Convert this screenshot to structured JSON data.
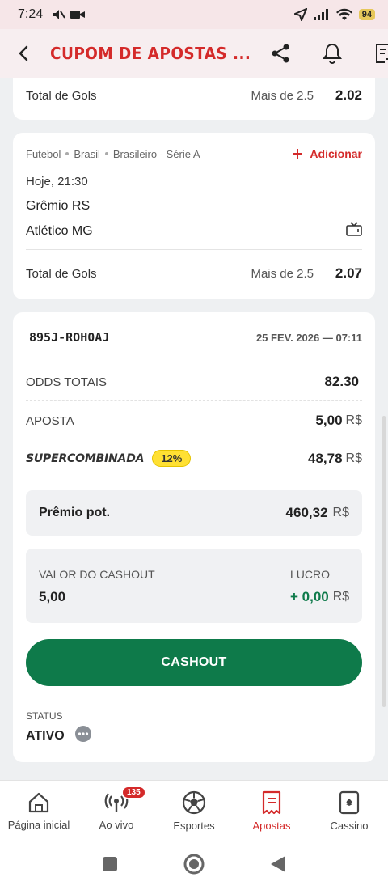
{
  "status_bar": {
    "time": "7:24",
    "battery": "94"
  },
  "header": {
    "title": "CUPOM DE APOSTAS ..."
  },
  "bet1": {
    "market": "Total de Gols",
    "selection": "Mais de 2.5",
    "odd": "2.02"
  },
  "bet2": {
    "crumbs": [
      "Futebol",
      "Brasil",
      "Brasileiro - Série A"
    ],
    "add_label": "Adicionar",
    "time": "Hoje, 21:30",
    "home": "Grêmio RS",
    "away": "Atlético MG",
    "market": "Total de Gols",
    "selection": "Mais de 2.5",
    "odd": "2.07"
  },
  "summary": {
    "code": "895J-ROH0AJ",
    "date": "25 FEV. 2026 — 07:11",
    "odds_label": "ODDS TOTAIS",
    "odds_value": "82.30",
    "stake_label": "APOSTA",
    "stake_value": "5,00",
    "currency": "R$",
    "super_label": "SUPERCOMBINADA",
    "super_pct": "12%",
    "super_value": "48,78",
    "prize_label": "Prêmio pot.",
    "prize_value": "460,32",
    "cashout_label": "VALOR DO CASHOUT",
    "cashout_value": "5,00",
    "profit_label": "LUCRO",
    "profit_value": "+ 0,00",
    "cashout_button": "CASHOUT",
    "status_label": "STATUS",
    "status_value": "ATIVO"
  },
  "nav": {
    "items": [
      {
        "label": "Página inicial"
      },
      {
        "label": "Ao vivo",
        "badge": "135"
      },
      {
        "label": "Esportes"
      },
      {
        "label": "Apostas"
      },
      {
        "label": "Cassino"
      }
    ]
  },
  "colors": {
    "brand": "#d42a2a",
    "cashout": "#0e7a4a",
    "profit": "#0e7a4a"
  }
}
